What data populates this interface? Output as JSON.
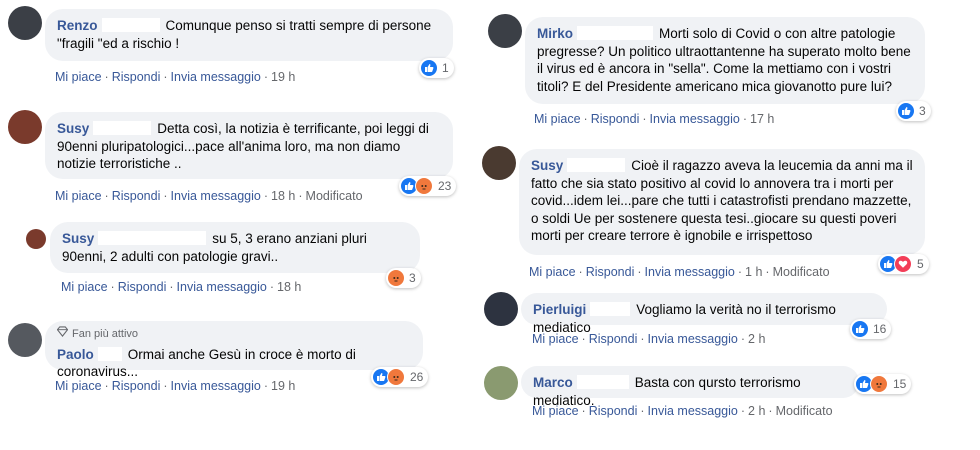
{
  "actions": {
    "like": "Mi piace",
    "reply": "Rispondi",
    "message": "Invia messaggio",
    "separator": "·"
  },
  "comments": [
    {
      "author": "Renzo",
      "text": "Comunque penso si tratti sempre di persone \"fragili \"ed a rischio !",
      "time": "19 h",
      "edited": "",
      "reactions": [
        "like-icon"
      ],
      "count": "1"
    },
    {
      "author": "Susy",
      "text": "Detta così, la notizia è terrificante, poi leggi di 90enni pluripatologici...pace all'anima loro, ma non diamo notizie terroristiche ..",
      "time": "18 h",
      "edited": "Modificato",
      "reactions": [
        "like-icon",
        "angry-icon"
      ],
      "count": "23"
    },
    {
      "author": "Susy",
      "text": "su 5, 3 erano anziani pluri 90enni, 2 adulti con patologie gravi..",
      "time": "18 h",
      "edited": "",
      "reactions": [
        "angry-icon"
      ],
      "count": "3"
    },
    {
      "badge": "Fan più attivo",
      "author": "Paolo",
      "text": "Ormai anche Gesù in croce è morto di coronavirus...",
      "time": "19 h",
      "edited": "",
      "reactions": [
        "like-icon",
        "angry-icon"
      ],
      "count": "26"
    },
    {
      "author": "Mirko",
      "text": "Morti solo di Covid o con altre patologie pregresse? Un politico ultraottantenne ha superato molto bene il virus ed è ancora in \"sella\". Come la mettiamo con i vostri titoli? E del Presidente americano mica giovanotto pure lui?",
      "time": "17 h",
      "edited": "",
      "reactions": [
        "like-icon"
      ],
      "count": "3"
    },
    {
      "author": "Susy",
      "text": "Cioè il ragazzo aveva la leucemia da anni ma il fatto che sia stato positivo al covid lo annovera tra i morti per covid...idem lei...pare che tutti i catastrofisti prendano mazzette, o soldi Ue per sostenere questa tesi..giocare su questi poveri morti per creare terrore è ignobile e irrispettoso",
      "time": "1 h",
      "edited": "Modificato",
      "reactions": [
        "like-icon",
        "love-icon"
      ],
      "count": "5"
    },
    {
      "author": "Pierluigi",
      "text": "Vogliamo la verità no il terrorismo mediatico",
      "time": "2 h",
      "edited": "",
      "reactions": [
        "like-icon"
      ],
      "count": "16"
    },
    {
      "author": "Marco",
      "text": "Basta con qursto terrorismo mediatico.",
      "time": "2 h",
      "edited": "Modificato",
      "reactions": [
        "like-icon",
        "angry-icon"
      ],
      "count": "15"
    }
  ]
}
